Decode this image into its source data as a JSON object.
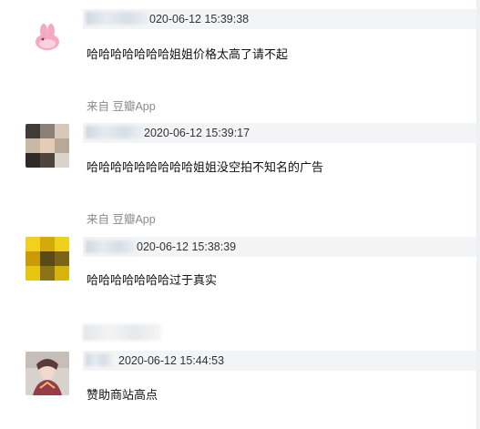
{
  "posts": [
    {
      "avatar_icon": "pink-cartoon-avatar-icon",
      "timestamp": "020-06-12 15:39:38",
      "content": "哈哈哈哈哈哈哈姐姐价格太高了请不起",
      "source": "来自 豆瓣App"
    },
    {
      "avatar_icon": "blurred-photo-avatar-icon",
      "timestamp": "2020-06-12 15:39:17",
      "content": "哈哈哈哈哈哈哈哈哈姐姐没空拍不知名的广告",
      "source": "来自 豆瓣App"
    },
    {
      "avatar_icon": "yellow-blurred-avatar-icon",
      "timestamp": "020-06-12 15:38:39",
      "content": "哈哈哈哈哈哈哈过于真实"
    },
    {
      "avatar_icon": "costume-person-avatar-icon",
      "timestamp": "2020-06-12 15:44:53",
      "content": "赞助商站高点"
    }
  ]
}
